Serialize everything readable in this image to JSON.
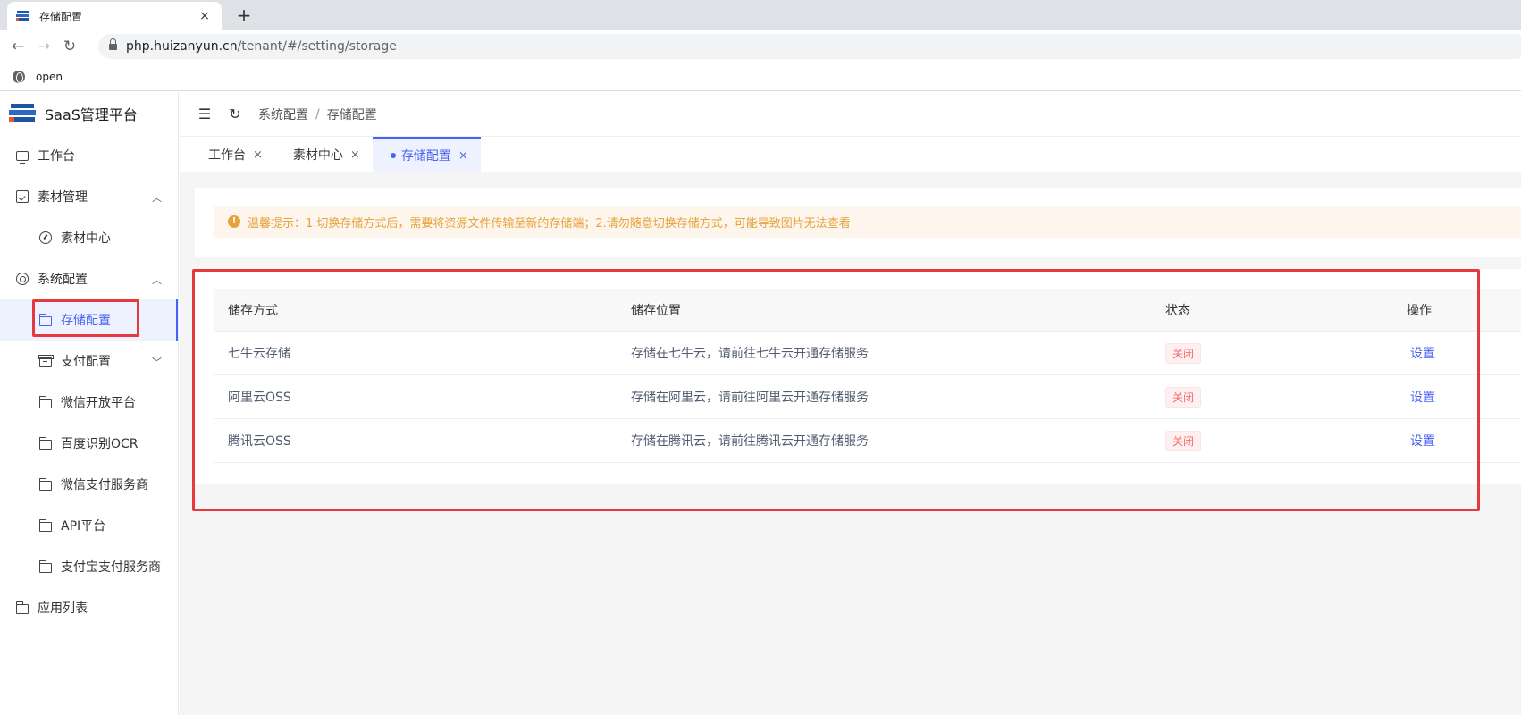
{
  "browser": {
    "tab_title": "存储配置",
    "close_tab": "×",
    "new_tab": "+",
    "back": "←",
    "forward": "→",
    "reload": "↻",
    "url_host": "php.huizanyun.cn",
    "url_path": "/tenant/#/setting/storage",
    "bookmark_label": "open"
  },
  "sidebar": {
    "logo_text": "SaaS管理平台",
    "items": [
      {
        "label": "工作台",
        "icon": "monitor-icon"
      },
      {
        "label": "素材管理",
        "icon": "image-icon",
        "arrow": "︿"
      },
      {
        "label": "素材中心",
        "icon": "gauge-icon"
      },
      {
        "label": "系统配置",
        "icon": "settings-icon",
        "arrow": "︿"
      },
      {
        "label": "存储配置",
        "icon": "folder-icon",
        "active": true
      },
      {
        "label": "支付配置",
        "icon": "box-icon",
        "arrow": "﹀"
      },
      {
        "label": "微信开放平台",
        "icon": "folder-icon"
      },
      {
        "label": "百度识别OCR",
        "icon": "folder-icon"
      },
      {
        "label": "微信支付服务商",
        "icon": "folder-icon"
      },
      {
        "label": "API平台",
        "icon": "folder-icon"
      },
      {
        "label": "支付宝支付服务商",
        "icon": "folder-icon"
      },
      {
        "label": "应用列表",
        "icon": "folder-icon"
      }
    ]
  },
  "header": {
    "fold_icon": "☰",
    "refresh_icon": "↻",
    "breadcrumb": [
      "系统配置",
      "存储配置"
    ],
    "separator": "/"
  },
  "page_tabs": [
    {
      "label": "工作台",
      "close": "×"
    },
    {
      "label": "素材中心",
      "close": "×"
    },
    {
      "label": "存储配置",
      "close": "×",
      "active": true
    }
  ],
  "alert": {
    "icon": "!",
    "text": "温馨提示：1.切换存储方式后，需要将资源文件传输至新的存储端；2.请勿随意切换存储方式，可能导致图片无法查看"
  },
  "table": {
    "headers": [
      "储存方式",
      "储存位置",
      "状态",
      "操作"
    ],
    "rows": [
      {
        "method": "七牛云存储",
        "location": "存储在七牛云，请前往七牛云开通存储服务",
        "status": "关闭",
        "action": "设置"
      },
      {
        "method": "阿里云OSS",
        "location": "存储在阿里云，请前往阿里云开通存储服务",
        "status": "关闭",
        "action": "设置"
      },
      {
        "method": "腾讯云OSS",
        "location": "存储在腾讯云，请前往腾讯云开通存储服务",
        "status": "关闭",
        "action": "设置"
      }
    ]
  },
  "colors": {
    "accent": "#4962f5",
    "highlight_box": "#e6393e",
    "warning": "#e6a23c",
    "status_off": "#f56c6c"
  }
}
